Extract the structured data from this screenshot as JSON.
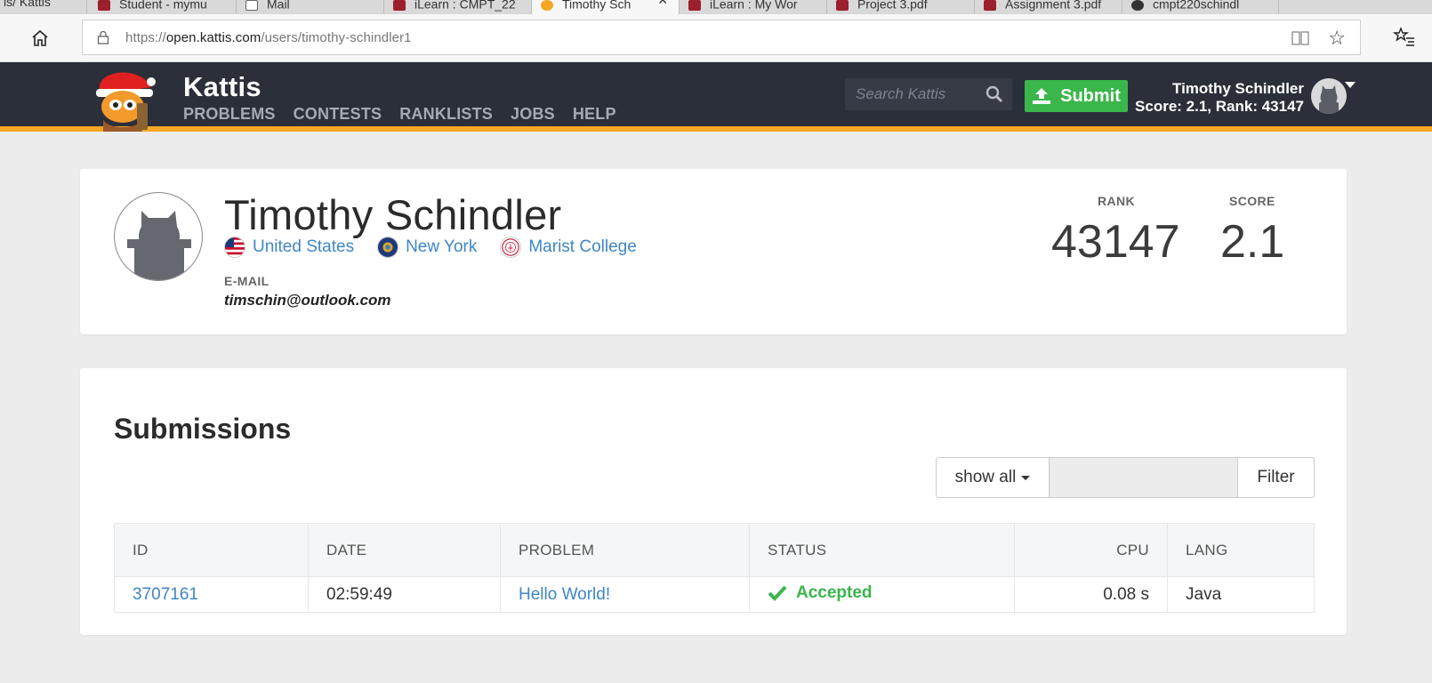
{
  "browser": {
    "tabs": [
      {
        "label": "is/ Kattis"
      },
      {
        "label": "Student - mymu"
      },
      {
        "label": "Mail"
      },
      {
        "label": "iLearn : CMPT_22"
      },
      {
        "label": "Timothy Sch",
        "active": true
      },
      {
        "label": "iLearn : My Wor"
      },
      {
        "label": "Project 3.pdf"
      },
      {
        "label": "Assignment 3.pdf"
      },
      {
        "label": "cmpt220schindl"
      }
    ],
    "url_scheme": "https://",
    "url_host": "open.kattis.com",
    "url_path": "/users/timothy-schindler1"
  },
  "header": {
    "brand": "Kattis",
    "nav": [
      "PROBLEMS",
      "CONTESTS",
      "RANKLISTS",
      "JOBS",
      "HELP"
    ],
    "search_placeholder": "Search Kattis",
    "submit_label": "Submit",
    "user_name": "Timothy Schindler",
    "user_stats": "Score: 2.1, Rank: 43147",
    "colors": {
      "bar": "#2b2f3a",
      "accent": "#f5a623",
      "submit": "#3ab64a"
    }
  },
  "profile": {
    "name": "Timothy Schindler",
    "country": "United States",
    "region": "New York",
    "school": "Marist College",
    "email_label": "E-MAIL",
    "email": "timschin@outlook.com",
    "rank_label": "RANK",
    "rank": "43147",
    "score_label": "SCORE",
    "score": "2.1"
  },
  "submissions": {
    "title": "Submissions",
    "filter_select": "show all",
    "filter_button": "Filter",
    "columns": [
      "ID",
      "DATE",
      "PROBLEM",
      "STATUS",
      "CPU",
      "LANG"
    ],
    "rows": [
      {
        "id": "3707161",
        "date": "02:59:49",
        "problem": "Hello World!",
        "status": "Accepted",
        "cpu": "0.08 s",
        "lang": "Java"
      }
    ],
    "colors": {
      "link": "#3f86c6",
      "accepted": "#3ab64a"
    }
  }
}
